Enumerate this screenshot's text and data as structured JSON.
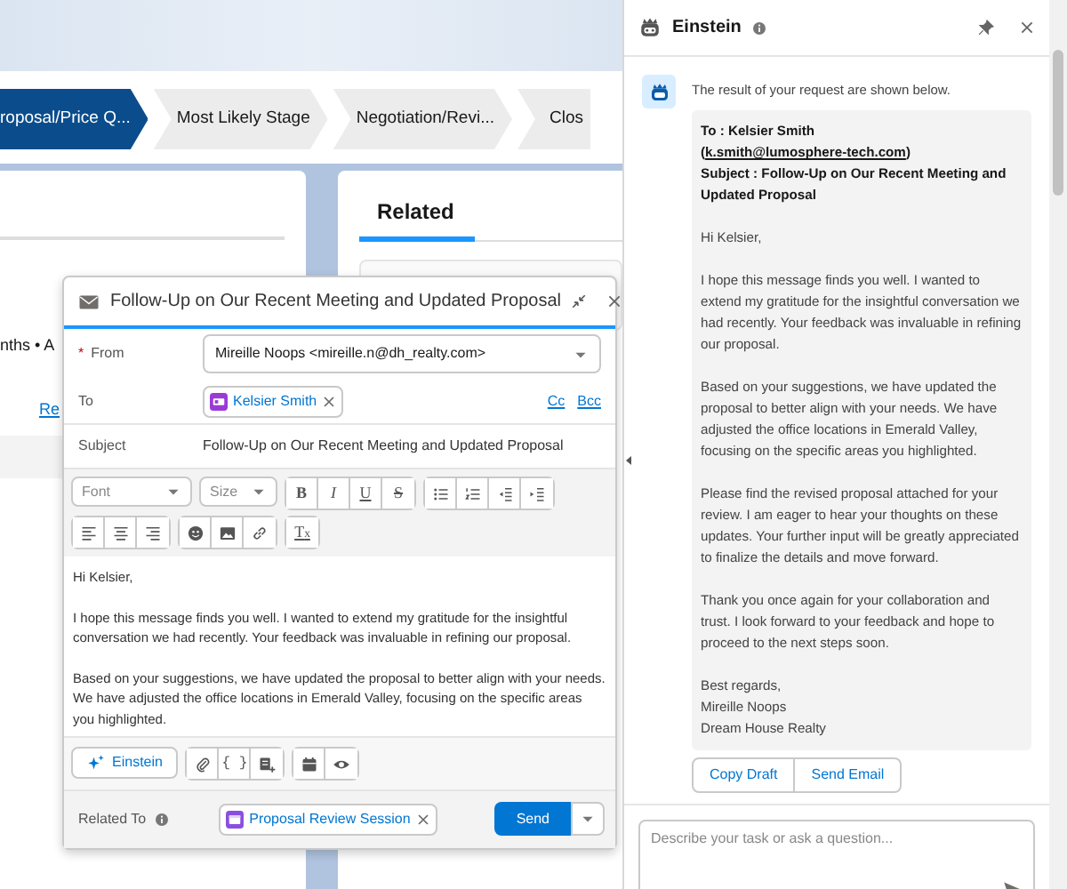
{
  "path": [
    {
      "label": "roposal/Price Q...",
      "selected": true
    },
    {
      "label": "Most Likely Stage",
      "selected": false
    },
    {
      "label": "Negotiation/Revi...",
      "selected": false
    },
    {
      "label": "Clos",
      "selected": false
    }
  ],
  "record_card": {
    "meta": "nths • A",
    "link": "Re"
  },
  "related_card": {
    "tab": "Related"
  },
  "composer": {
    "title": "Follow-Up on Our Recent Meeting and Updated Proposal",
    "from": {
      "required_mark": "*",
      "label": "From",
      "value": "Mireille Noops <mireille.n@dh_realty.com>"
    },
    "to": {
      "label": "To",
      "recipient": "Kelsier Smith",
      "cc": "Cc",
      "bcc": "Bcc"
    },
    "subject": {
      "label": "Subject",
      "value": "Follow-Up on Our Recent Meeting and Updated Proposal"
    },
    "font_select": "Font",
    "size_select": "Size",
    "format_buttons": [
      {
        "text": "B",
        "kind": "bold"
      },
      {
        "text": "I",
        "kind": "italic"
      },
      {
        "text": "U",
        "kind": "underline"
      },
      {
        "text": "S",
        "kind": "strike"
      }
    ],
    "clear_format": "T$_{x}$",
    "merge_field": "{ }",
    "body": [
      "Hi Kelsier,",
      "I hope this message finds you well. I wanted to extend my gratitude for the insightful conversation we had recently. Your feedback was invaluable in refining our proposal.",
      "Based on your suggestions, we have updated the proposal to better align with your needs. We have adjusted the office locations in Emerald Valley, focusing on the specific areas you highlighted."
    ],
    "einstein_button": "Einstein",
    "related_to": {
      "label": "Related To",
      "record": "Proposal Review Session"
    },
    "send": "Send"
  },
  "einstein": {
    "title": "Einstein",
    "intro": "The result of your request are shown below.",
    "draft": {
      "to_prefix": "To : Kelsier Smith (",
      "to_email": "k.smith@lumosphere-tech.com",
      "to_suffix": ")",
      "subject": "Subject : Follow-Up on Our Recent Meeting and Updated Proposal",
      "paragraphs": [
        "Hi Kelsier,",
        "I hope this message finds you well. I wanted to extend my gratitude for the insightful conversation we had recently. Your feedback was invaluable in refining our proposal.",
        "Based on your suggestions, we have updated the proposal to better align with your needs. We have adjusted the office locations in Emerald Valley, focusing on the specific areas you highlighted.",
        "Please find the revised proposal attached for your review. I am eager to hear your thoughts on these updates. Your further input will be greatly appreciated to finalize the details and move forward.",
        "Thank you once again for your collaboration and trust. I look forward to your feedback and hope to proceed to the next steps soon."
      ],
      "signature": [
        "Best regards,",
        "Mireille Noops",
        "Dream House Realty"
      ]
    },
    "actions": [
      "Copy Draft",
      "Send Email"
    ],
    "prompt": {
      "placeholder": "Describe your task or ask a question..."
    }
  }
}
